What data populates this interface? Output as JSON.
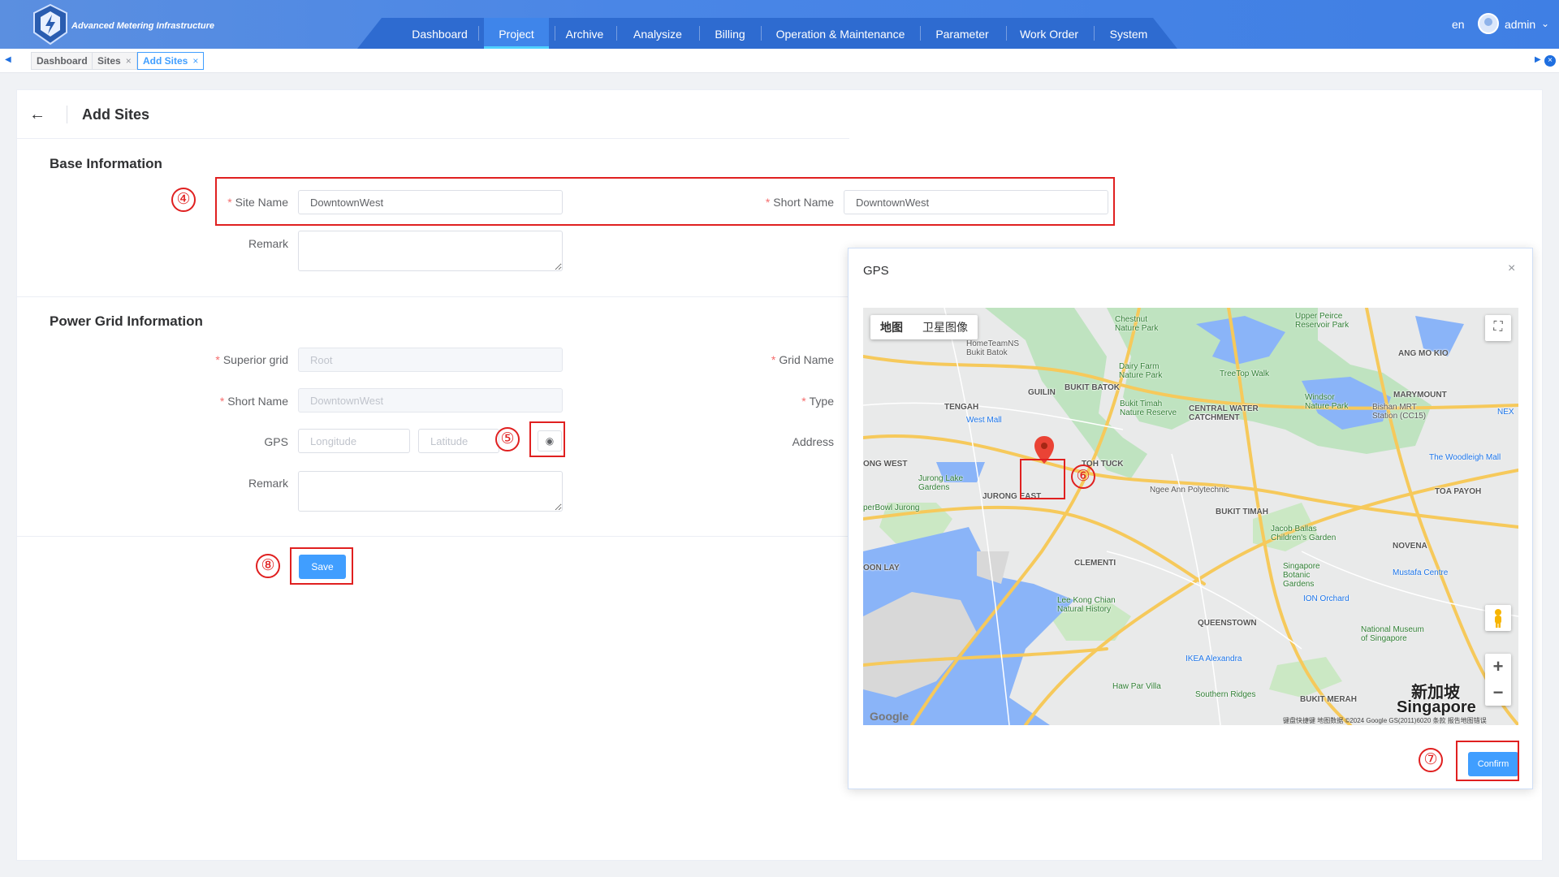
{
  "app": {
    "title": "Advanced Metering Infrastructure",
    "lang": "en",
    "user": "admin"
  },
  "nav": [
    {
      "label": "Dashboard",
      "active": false
    },
    {
      "label": "Project",
      "active": true
    },
    {
      "label": "Archive",
      "active": false
    },
    {
      "label": "Analysize",
      "active": false
    },
    {
      "label": "Billing",
      "active": false
    },
    {
      "label": "Operation & Maintenance",
      "active": false
    },
    {
      "label": "Parameter",
      "active": false
    },
    {
      "label": "Work Order",
      "active": false
    },
    {
      "label": "System",
      "active": false
    }
  ],
  "tabs": [
    {
      "label": "Dashboard",
      "closable": false,
      "active": false
    },
    {
      "label": "Sites",
      "closable": true,
      "active": false
    },
    {
      "label": "Add Sites",
      "closable": true,
      "active": true
    }
  ],
  "page": {
    "title": "Add Sites"
  },
  "base_info": {
    "section_title": "Base Information",
    "site_name_label": "Site Name",
    "site_name_value": "DowntownWest",
    "short_name_label": "Short Name",
    "short_name_value": "DowntownWest",
    "remark_label": "Remark"
  },
  "power_grid": {
    "section_title": "Power Grid Information",
    "superior_grid_label": "Superior grid",
    "superior_grid_placeholder": "Root",
    "grid_name_label": "Grid Name",
    "short_name_label": "Short Name",
    "short_name_placeholder": "DowntownWest",
    "type_label": "Type",
    "gps_label": "GPS",
    "longitude_placeholder": "Longitude",
    "latitude_placeholder": "Latitude",
    "address_label": "Address",
    "remark_label": "Remark"
  },
  "actions": {
    "save_label": "Save"
  },
  "annotations": [
    "④",
    "⑤",
    "⑥",
    "⑦",
    "⑧"
  ],
  "dialog": {
    "title": "GPS",
    "close": "×",
    "confirm_label": "Confirm",
    "map_type": [
      "地图",
      "卫星图像"
    ],
    "map_labels": {
      "bukit_batok": "BUKIT BATOK",
      "guilin": "GUILIN",
      "tengah": "TENGAH",
      "bukit_timah_reserve": "Bukit Timah\nNature Reserve",
      "central_water": "CENTRAL WATER\nCATCHMENT",
      "windsor": "Windsor\nNature Park",
      "marymount": "MARYMOUNT",
      "ang_mo_kio": "ANG MO KIO",
      "upper_peirce": "Upper Peirce\nReservoir Park",
      "chestnut": "Chestnut\nNature Park",
      "dairy_farm": "Dairy Farm\nNature Park",
      "treetop": "TreeTop Walk",
      "homeTeamNS": "HomeTeamNS\nBukit Batok",
      "jurong_east": "JURONG EAST",
      "jurong_lake": "Jurong Lake\nGardens",
      "toh_tuck": "TOH TUCK",
      "ngee_ann": "Ngee Ann Polytechnic",
      "bukit_timah": "BUKIT TIMAH",
      "toa_payoh": "TOA PAYOH",
      "woodleigh": "The Woodleigh Mall",
      "novena": "NOVENA",
      "jacob_ballas": "Jacob Ballas\nChildren's Garden",
      "botanic": "Singapore\nBotanic\nGardens",
      "mustafa": "Mustafa Centre",
      "ion": "ION Orchard",
      "national_museum": "National Museum\nof Singapore",
      "clementi": "CLEMENTI",
      "lee_kong_chian": "Lee Kong Chian\nNatural History",
      "queenstown": "QUEENSTOWN",
      "ikea": "IKEA Alexandra",
      "haw_par": "Haw Par Villa",
      "southern_ridges": "Southern Ridges",
      "bukit_merah": "BUKIT MERAH",
      "singapore_cn": "新加坡",
      "singapore": "Singapore",
      "jurong_west": "ONG WEST",
      "boon_lay": "OON LAY",
      "superbowl": "perBowl Jurong",
      "west_mall": "West Mall",
      "nex": "NEX",
      "bishan": "Bishan MRT\nStation (CC15)"
    },
    "google": "Google",
    "attribution": "键盘快捷键  地图数据 ©2024 Google GS(2011)6020  条款  报告地图错误"
  }
}
